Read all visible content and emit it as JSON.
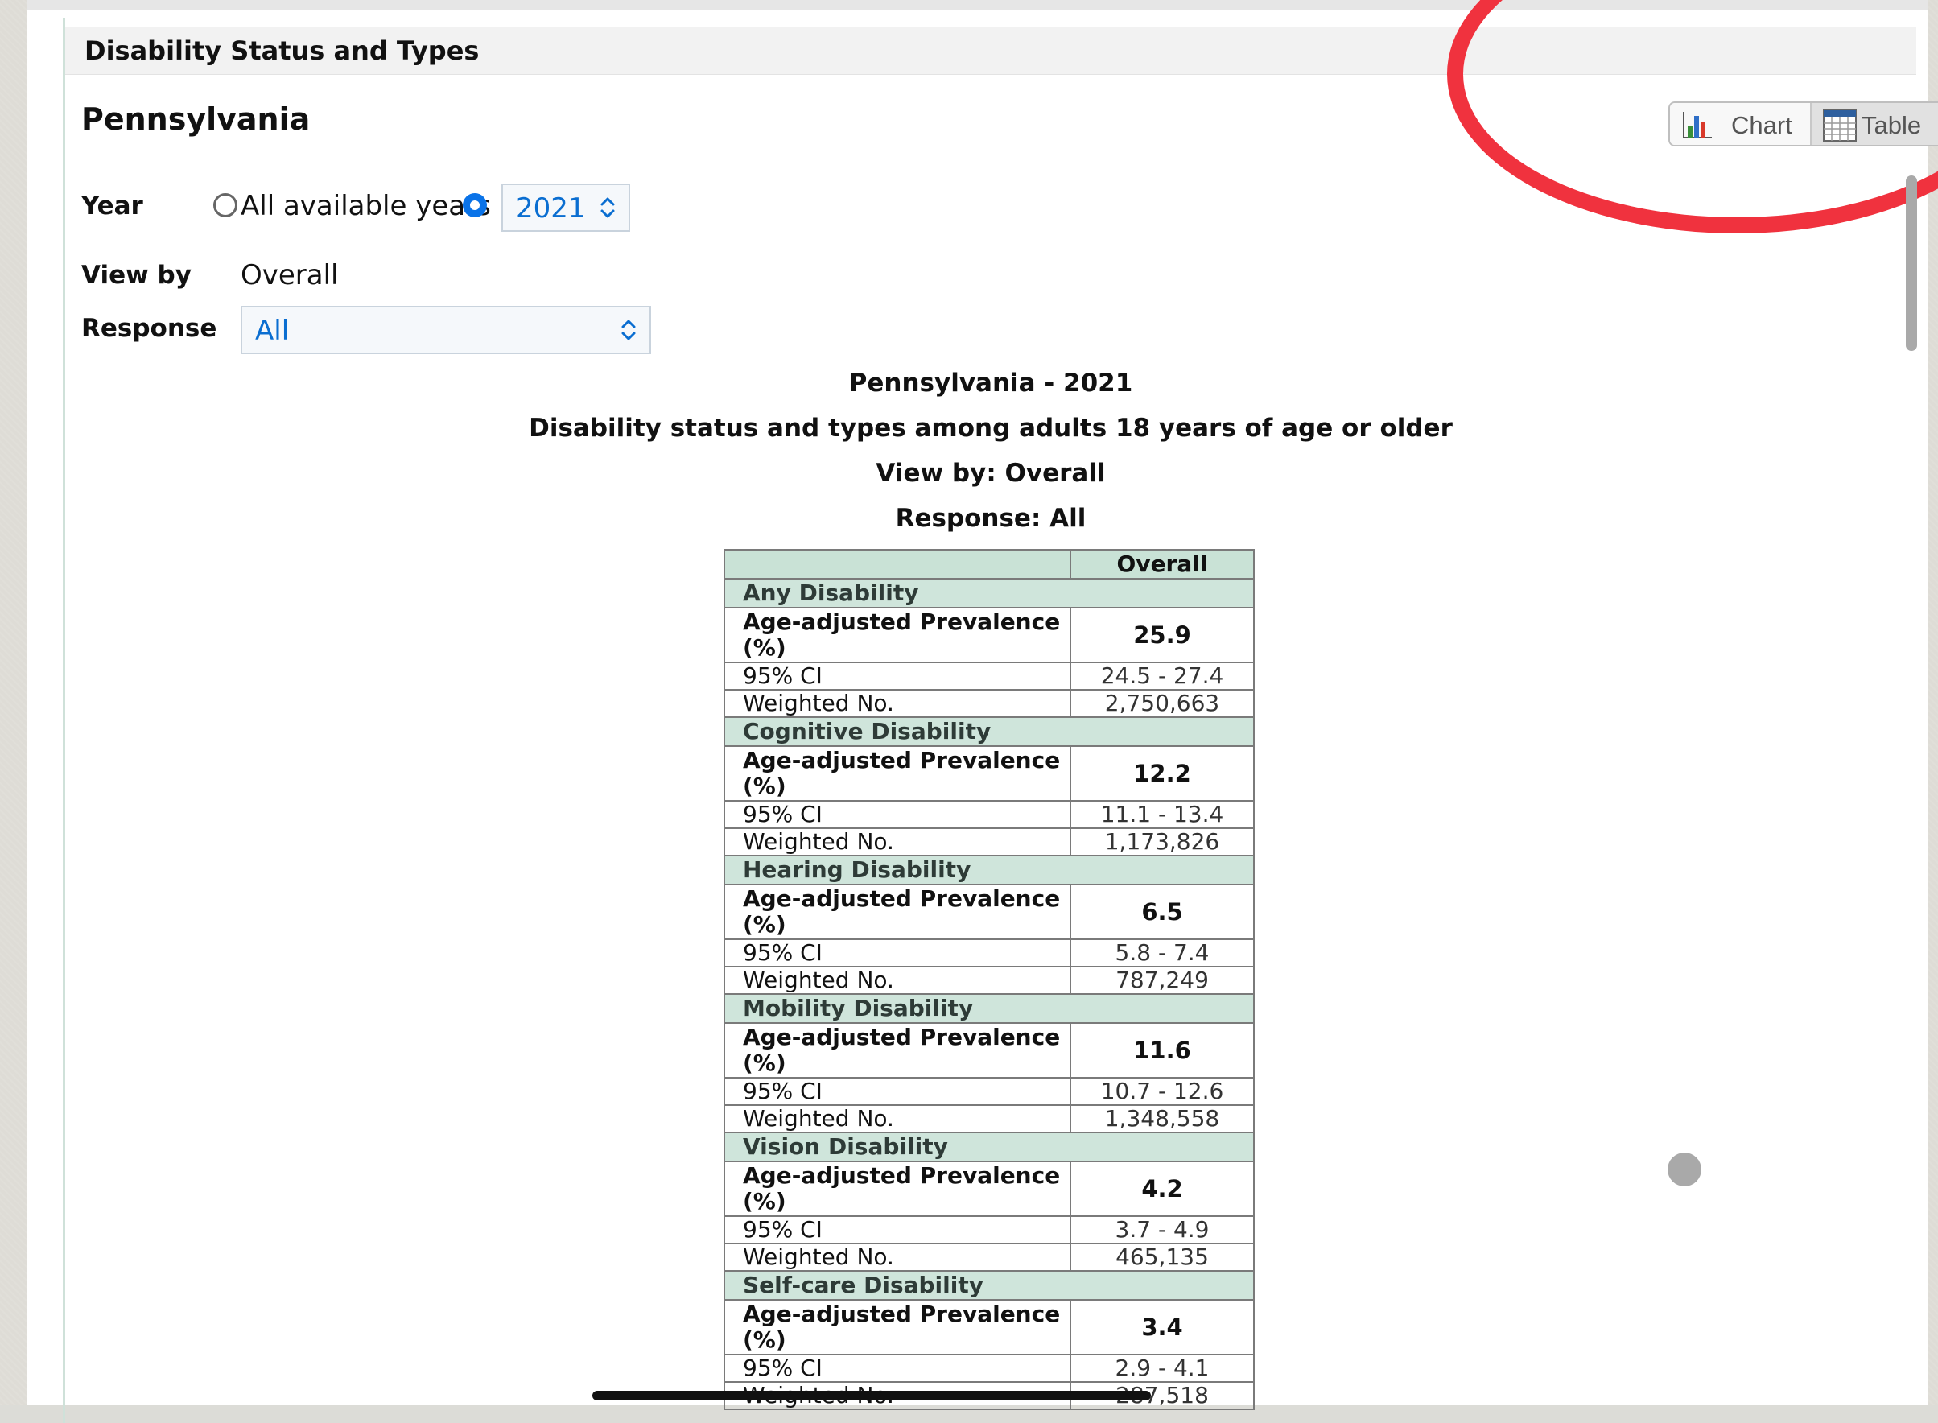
{
  "header": {
    "title": "Disability Status and Types"
  },
  "location": "Pennsylvania",
  "filters": {
    "year_label": "Year",
    "all_years_label": "All available years",
    "year_value": "2021",
    "viewby_label": "View by",
    "viewby_value": "Overall",
    "response_label": "Response",
    "response_value": "All"
  },
  "view_toggle": {
    "chart_label": "Chart",
    "table_label": "Table",
    "selected": "Table"
  },
  "report": {
    "heading": "Pennsylvania - 2021",
    "subheading": "Disability status and types among adults 18 years of age or older",
    "viewby_line": "View by: Overall",
    "response_line": "Response: All"
  },
  "table": {
    "column_header": "Overall",
    "sections": [
      {
        "name": "Any Disability",
        "prevalence_label": "Age-adjusted Prevalence (%)",
        "prevalence": "25.9",
        "ci_label": "95% CI",
        "ci": "24.5 - 27.4",
        "weighted_label": "Weighted No.",
        "weighted": "2,750,663"
      },
      {
        "name": "Cognitive Disability",
        "prevalence_label": "Age-adjusted Prevalence (%)",
        "prevalence": "12.2",
        "ci_label": "95% CI",
        "ci": "11.1 - 13.4",
        "weighted_label": "Weighted No.",
        "weighted": "1,173,826"
      },
      {
        "name": "Hearing Disability",
        "prevalence_label": "Age-adjusted Prevalence (%)",
        "prevalence": "6.5",
        "ci_label": "95% CI",
        "ci": "5.8 - 7.4",
        "weighted_label": "Weighted No.",
        "weighted": "787,249"
      },
      {
        "name": "Mobility Disability",
        "prevalence_label": "Age-adjusted Prevalence (%)",
        "prevalence": "11.6",
        "ci_label": "95% CI",
        "ci": "10.7 - 12.6",
        "weighted_label": "Weighted No.",
        "weighted": "1,348,558"
      },
      {
        "name": "Vision Disability",
        "prevalence_label": "Age-adjusted Prevalence (%)",
        "prevalence": "4.2",
        "ci_label": "95% CI",
        "ci": "3.7 - 4.9",
        "weighted_label": "Weighted No.",
        "weighted": "465,135"
      },
      {
        "name": "Self-care Disability",
        "prevalence_label": "Age-adjusted Prevalence (%)",
        "prevalence": "3.4",
        "ci_label": "95% CI",
        "ci": "2.9 - 4.1",
        "weighted_label": "Weighted No.",
        "weighted": "287,518"
      }
    ]
  },
  "colors": {
    "accent_blue": "#0a73e8",
    "table_header_green": "#c9e2d6",
    "annotation_red": "#f0323e"
  }
}
